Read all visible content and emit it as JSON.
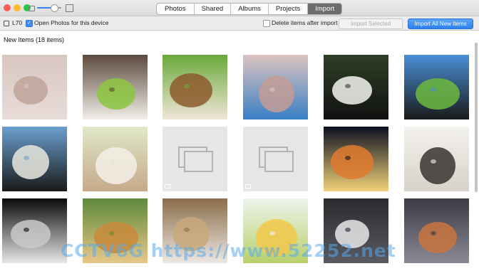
{
  "window": {
    "traffic_lights": [
      {
        "name": "close-button",
        "color": "#fc5f57"
      },
      {
        "name": "minimize-button",
        "color": "#fdbc2e"
      },
      {
        "name": "zoom-button",
        "color": "#28c840"
      }
    ],
    "zoom_slider_value": 0.7
  },
  "tabs": [
    {
      "label": "Photos",
      "active": false
    },
    {
      "label": "Shared",
      "active": false
    },
    {
      "label": "Albums",
      "active": false
    },
    {
      "label": "Projects",
      "active": false
    },
    {
      "label": "Import",
      "active": true
    }
  ],
  "import_bar": {
    "device_name": "L70",
    "open_photos_label": "Open Photos for this device",
    "open_photos_checked": true,
    "delete_after_label": "Delete items after import",
    "delete_after_checked": false,
    "import_selected_label": "Import Selected",
    "import_all_label": "Import All New Items"
  },
  "section_title": "New Items (18 items)",
  "thumbnails": [
    {
      "subject": "hamster in hand",
      "kind": "photo",
      "colors": [
        "#d9c6c0",
        "#bfa49b",
        "#e8dcd8"
      ]
    },
    {
      "subject": "kitten in frog hat",
      "kind": "photo",
      "colors": [
        "#5c4a3d",
        "#8cc63f",
        "#f1efe9"
      ]
    },
    {
      "subject": "beagle puppy",
      "kind": "photo",
      "colors": [
        "#6aa83a",
        "#8c5a2b",
        "#f0e6d8"
      ]
    },
    {
      "subject": "piglet",
      "kind": "photo",
      "colors": [
        "#dcc4c0",
        "#c39c96",
        "#3a7fc6"
      ]
    },
    {
      "subject": "pandas",
      "kind": "photo",
      "colors": [
        "#2f3f26",
        "#f4f4f0",
        "#111111"
      ]
    },
    {
      "subject": "black horse",
      "kind": "photo",
      "colors": [
        "#4a8fd6",
        "#6cb83e",
        "#1a1a1a"
      ]
    },
    {
      "subject": "penguins",
      "kind": "photo",
      "colors": [
        "#6aa0cf",
        "#e9e7de",
        "#1a1a1a"
      ]
    },
    {
      "subject": "white fluffy cat",
      "kind": "photo",
      "colors": [
        "#dfe8c8",
        "#f5f0e8",
        "#c6a98a"
      ]
    },
    {
      "subject": "",
      "kind": "placeholder",
      "colors": [
        "#e6e6e6",
        "#b3b3b3",
        "#ffffff"
      ]
    },
    {
      "subject": "",
      "kind": "placeholder",
      "colors": [
        "#e6e6e6",
        "#b3b3b3",
        "#ffffff"
      ]
    },
    {
      "subject": "sunset sky",
      "kind": "photo",
      "colors": [
        "#0b1020",
        "#e07a2f",
        "#f4d27a"
      ]
    },
    {
      "subject": "husky puppy",
      "kind": "photo",
      "colors": [
        "#f4f2ee",
        "#3a3430",
        "#d7d2c9"
      ]
    },
    {
      "subject": "moon and tree",
      "kind": "photo",
      "colors": [
        "#0a0a0a",
        "#c9c9c9",
        "#e8e8e8"
      ]
    },
    {
      "subject": "golden retriever",
      "kind": "photo",
      "colors": [
        "#5f8a3c",
        "#c98a3a",
        "#e8c888"
      ]
    },
    {
      "subject": "cat in paper bag",
      "kind": "photo",
      "colors": [
        "#8b6d4a",
        "#c9a87a",
        "#ece8e2"
      ]
    },
    {
      "subject": "yellow chicks",
      "kind": "photo",
      "colors": [
        "#eef4ec",
        "#f2c84b",
        "#b8d06a"
      ]
    },
    {
      "subject": "husky face",
      "kind": "photo",
      "colors": [
        "#2a2a2e",
        "#e8e8ea",
        "#5a5a62"
      ]
    },
    {
      "subject": "stormy sky",
      "kind": "photo",
      "colors": [
        "#3c3a44",
        "#c9743e",
        "#8a8a96"
      ]
    }
  ],
  "watermark": "CCTV6G https://www.52252.net"
}
